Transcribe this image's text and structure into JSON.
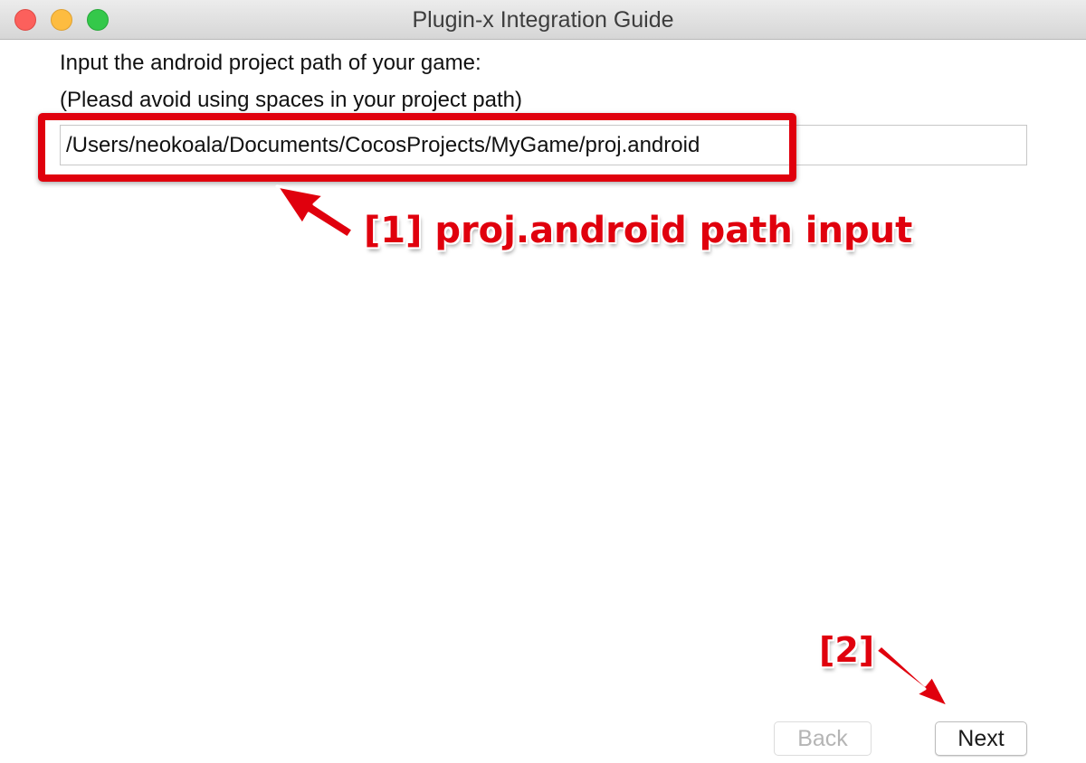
{
  "window": {
    "title": "Plugin-x Integration Guide",
    "controls": {
      "close_icon": "close-icon",
      "minimize_icon": "minimize-icon",
      "maximize_icon": "maximize-icon"
    }
  },
  "content": {
    "prompt": "Input the android project path of your game:",
    "hint": "(Pleasd avoid using spaces in your project path)",
    "path_value": "/Users/neokoala/Documents/CocosProjects/MyGame/proj.android"
  },
  "annotations": {
    "step1": "[1] proj.android path input",
    "step2": "[2]",
    "color": "#e0000d"
  },
  "buttons": {
    "back_label": "Back",
    "next_label": "Next"
  }
}
